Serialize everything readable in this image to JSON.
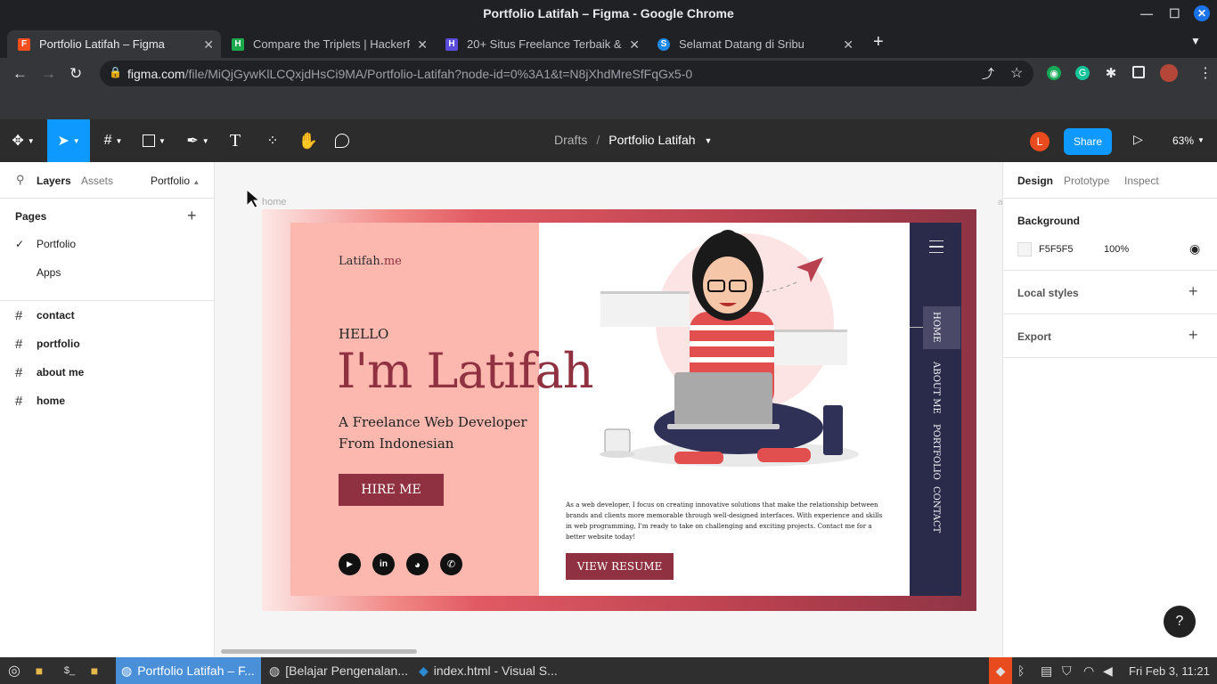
{
  "window_title": "Portfolio Latifah – Figma - Google Chrome",
  "tabs": [
    {
      "label": "Portfolio Latifah – Figma",
      "favicon": "figma-icon"
    },
    {
      "label": "Compare the Triplets | HackerRank",
      "favicon": "hackerrank-icon"
    },
    {
      "label": "20+ Situs Freelance Terbaik &",
      "favicon": "freelance-icon"
    },
    {
      "label": "Selamat Datang di Sribu",
      "favicon": "sribu-icon"
    }
  ],
  "url": {
    "domain": "figma.com",
    "path": "/file/MiQjGywKlLCQxjdHsCi9MA/Portfolio-Latifah?node-id=0%3A1&t=N8jXhdMreSfFqGx5-0"
  },
  "toolbar": {
    "breadcrumb_parent": "Drafts",
    "breadcrumb_sep": "/",
    "file_name": "Portfolio Latifah",
    "avatar": "L",
    "share": "Share",
    "zoom": "63%",
    "accent": "#0d99ff"
  },
  "left_panel": {
    "tabs": {
      "layers": "Layers",
      "assets": "Assets",
      "page": "Portfolio"
    },
    "pages_title": "Pages",
    "pages": [
      "Portfolio",
      "Apps"
    ],
    "frames": [
      "contact",
      "portfolio",
      "about me",
      "home"
    ]
  },
  "right_panel": {
    "tabs": {
      "design": "Design",
      "prototype": "Prototype",
      "inspect": "Inspect"
    },
    "background_title": "Background",
    "bg_hex": "F5F5F5",
    "bg_opacity": "100%",
    "local_styles": "Local styles",
    "export": "Export"
  },
  "frame": {
    "label": "home",
    "logo_main": "Latifah.",
    "logo_sub": "me",
    "hello": "HELLO",
    "headline": "I'm Latifah",
    "tagline1": "A Freelance Web Developer",
    "tagline2": "From Indonesian",
    "hire_button": "HIRE ME",
    "description": "As a web developer, I focus on creating innovative solutions that make the relationship between brands and clients more memorable through well-designed interfaces. With experience and skills in web programming, I'm ready to take on challenging and exciting projects. Contact me for a better website today!",
    "resume_button": "VIEW RESUME",
    "nav": [
      "HOME",
      "ABOUT ME",
      "PORTFOLIO",
      "CONTACT"
    ],
    "colors": {
      "pink": "#fcb8ae",
      "maroon": "#8f3140",
      "navy": "#2a2a4a"
    }
  },
  "help": "?",
  "taskbar": {
    "items": [
      "Portfolio Latifah – F...",
      "[Belajar Pengenalan...",
      "index.html - Visual S..."
    ],
    "clock": "Fri Feb  3, 11:21"
  }
}
